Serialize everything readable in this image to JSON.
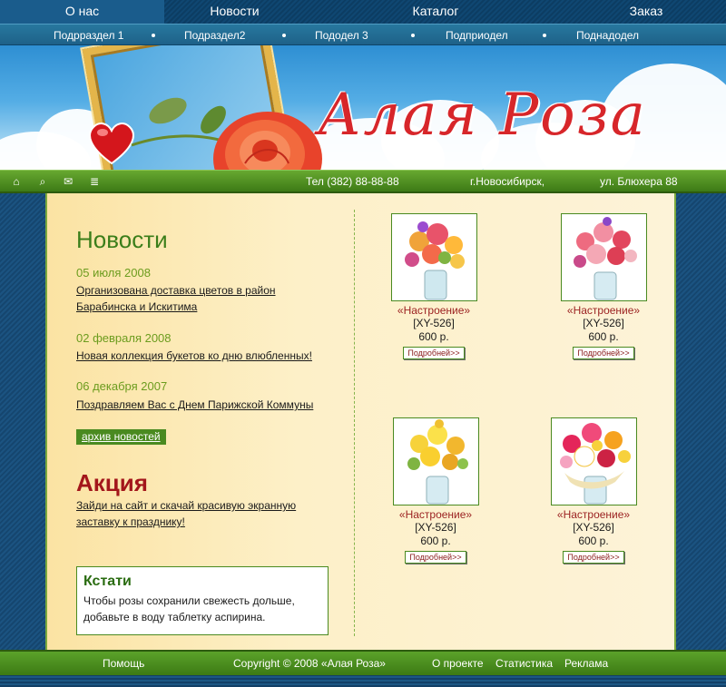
{
  "nav": {
    "items": [
      {
        "label": "О нас",
        "active": true
      },
      {
        "label": "Новости",
        "active": false
      },
      {
        "label": "Каталог",
        "active": false
      },
      {
        "label": "Заказ",
        "active": false
      }
    ]
  },
  "subnav": {
    "items": [
      "Подрраздел 1",
      "Подраздел2",
      "Пододел 3",
      "Подприодел",
      "Поднадодел"
    ]
  },
  "header": {
    "logo_text": "Алая Роза"
  },
  "infobar": {
    "icons": [
      "home-icon",
      "search-icon",
      "mail-icon",
      "sitemap-icon"
    ],
    "phone": "Тел (382) 88-88-88",
    "city": "г.Новосибирск,",
    "street": "ул. Блюхера 88"
  },
  "news": {
    "title": "Новости",
    "items": [
      {
        "date": "05 июля 2008",
        "text": "Организована доставка цветов в район Барабинска и Искитима"
      },
      {
        "date": "02 февраля 2008",
        "text": "Новая коллекция букетов ко дню влюбленных!"
      },
      {
        "date": "06 декабря 2007",
        "text": "Поздравляем Вас с Днем Парижской Коммуны"
      }
    ],
    "archive_label": "архив новостей"
  },
  "promo": {
    "title": "Акция",
    "text": "Зайди на сайт и скачай красивую экранную заставку к празднику!"
  },
  "tip": {
    "title": "Кстати",
    "text": "Чтобы розы сохранили свежесть дольше, добавьте в воду таблетку аспирина."
  },
  "products": [
    {
      "name": "«Настроение»",
      "sku": "[XY-526]",
      "price": "600 р.",
      "more": "Подробней>>"
    },
    {
      "name": "«Настроение»",
      "sku": "[XY-526]",
      "price": "600 р.",
      "more": "Подробней>>"
    },
    {
      "name": "«Настроение»",
      "sku": "[XY-526]",
      "price": "600 р.",
      "more": "Подробней>>"
    },
    {
      "name": "«Настроение»",
      "sku": "[XY-526]",
      "price": "600 р.",
      "more": "Подробней>>"
    }
  ],
  "footer": {
    "help": "Помощь",
    "copyright": "Copyright © 2008 «Алая Роза»",
    "about": "О проекте",
    "stats": "Статистика",
    "ads": "Реклама"
  },
  "colors": {
    "nav_dark": "#0c3d63",
    "green": "#4a8a20",
    "title_green": "#3b7e1a",
    "accent_red": "#a3161b",
    "logo_red": "#d7262a",
    "content_bg": "#fdf0c8"
  }
}
